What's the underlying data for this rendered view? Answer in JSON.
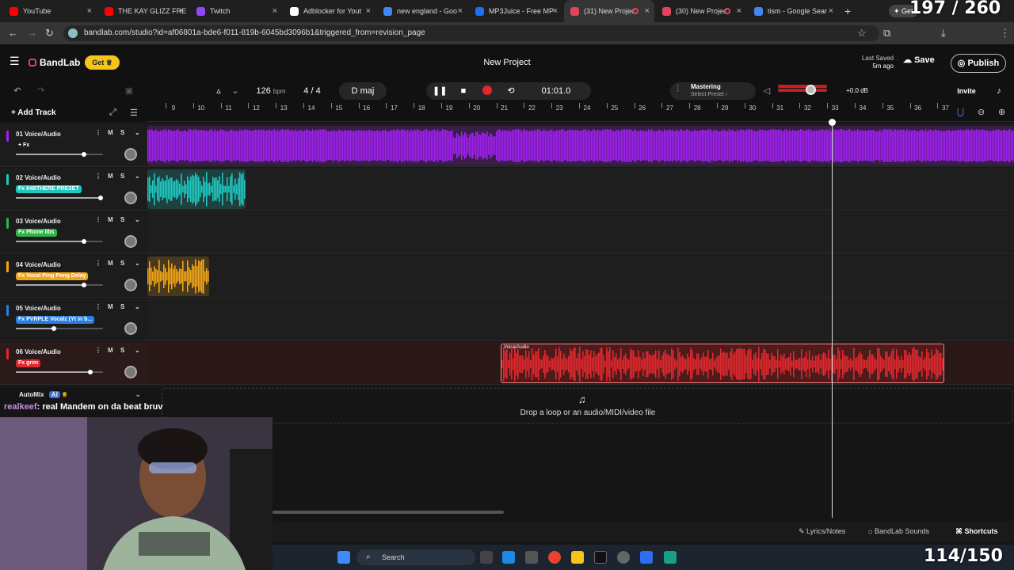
{
  "browser": {
    "tabs": [
      {
        "title": "YouTube",
        "color": "#ff0000"
      },
      {
        "title": "THE KAY GLIZZ FRE",
        "color": "#ff0000"
      },
      {
        "title": "Twitch",
        "color": "#9146ff"
      },
      {
        "title": "Adblocker for Yout",
        "color": "#ffffff"
      },
      {
        "title": "new england - Goo",
        "color": "#4285f4"
      },
      {
        "title": "MP3Juice - Free MP",
        "color": "#1a73e8"
      },
      {
        "title": "(31) New Projec",
        "color": "#e0455b"
      },
      {
        "title": "(30) New Projec",
        "color": "#e0455b"
      },
      {
        "title": "tism - Google Sear",
        "color": "#4285f4"
      }
    ],
    "url": "bandlab.com/studio?id=af06801a-bde6-f011-819b-6045bd3096b1&triggered_from=revision_page",
    "get_label": "Get"
  },
  "app": {
    "brand": "BandLab",
    "get_button": "Get",
    "project_title": "New Project",
    "last_saved_label": "Last Saved",
    "last_saved_value": "5m ago",
    "save_label": "Save",
    "publish_label": "Publish",
    "invite_label": "Invite"
  },
  "transport": {
    "bpm": "126",
    "bpm_unit": "bpm",
    "time_sig": "4 / 4",
    "key": "D maj",
    "time": "01:01.0",
    "mastering_label": "Mastering",
    "mastering_preset": "Select Preset",
    "volume_db": "+0.0 dB"
  },
  "tracks_header": {
    "add_track": "Add Track"
  },
  "ruler": [
    "9",
    "10",
    "11",
    "12",
    "13",
    "14",
    "15",
    "16",
    "17",
    "18",
    "19",
    "20",
    "21",
    "22",
    "23",
    "24",
    "25",
    "26",
    "27",
    "28",
    "29",
    "30",
    "31",
    "32",
    "33",
    "34",
    "35",
    "36",
    "37"
  ],
  "tracks": [
    {
      "name": "01  Voice/Audio",
      "fx": "+ Fx",
      "color": "#a020f0",
      "volume": 0.78
    },
    {
      "name": "02  Voice/Audio",
      "fx": "Fx IH8ITHERE PRESET",
      "color": "#1fc7c0",
      "volume": 0.97
    },
    {
      "name": "03  Voice/Audio",
      "fx": "Fx Phone libs",
      "color": "#2fb34a",
      "volume": 0.78
    },
    {
      "name": "04  Voice/Audio",
      "fx": "Fx Vocal Ping Pong Delay",
      "color": "#f2a516",
      "volume": 0.78
    },
    {
      "name": "05  Voice/Audio",
      "fx": "Fx PVRPLE Vocalz (Yt in b...",
      "color": "#2c7fe0",
      "volume": 0.44
    },
    {
      "name": "06  Voice/Audio",
      "fx": "Fx grim",
      "color": "#e0282d",
      "volume": 0.85
    }
  ],
  "clip_label": "Voice/Audio",
  "dropzone": "Drop a loop or an audio/MIDI/video file",
  "automix": "AutoMix",
  "automix_badge": "AI",
  "chat": {
    "user": "realkeef",
    "message": ": real Mandem on da beat bruv"
  },
  "bottom": {
    "lyrics": "Lyrics/Notes",
    "sounds": "BandLab Sounds",
    "shortcuts": "Shortcuts"
  },
  "taskbar": {
    "search": "Search"
  },
  "overlay": {
    "top_counter": "197 / 260",
    "bottom_counter": "114/150"
  }
}
